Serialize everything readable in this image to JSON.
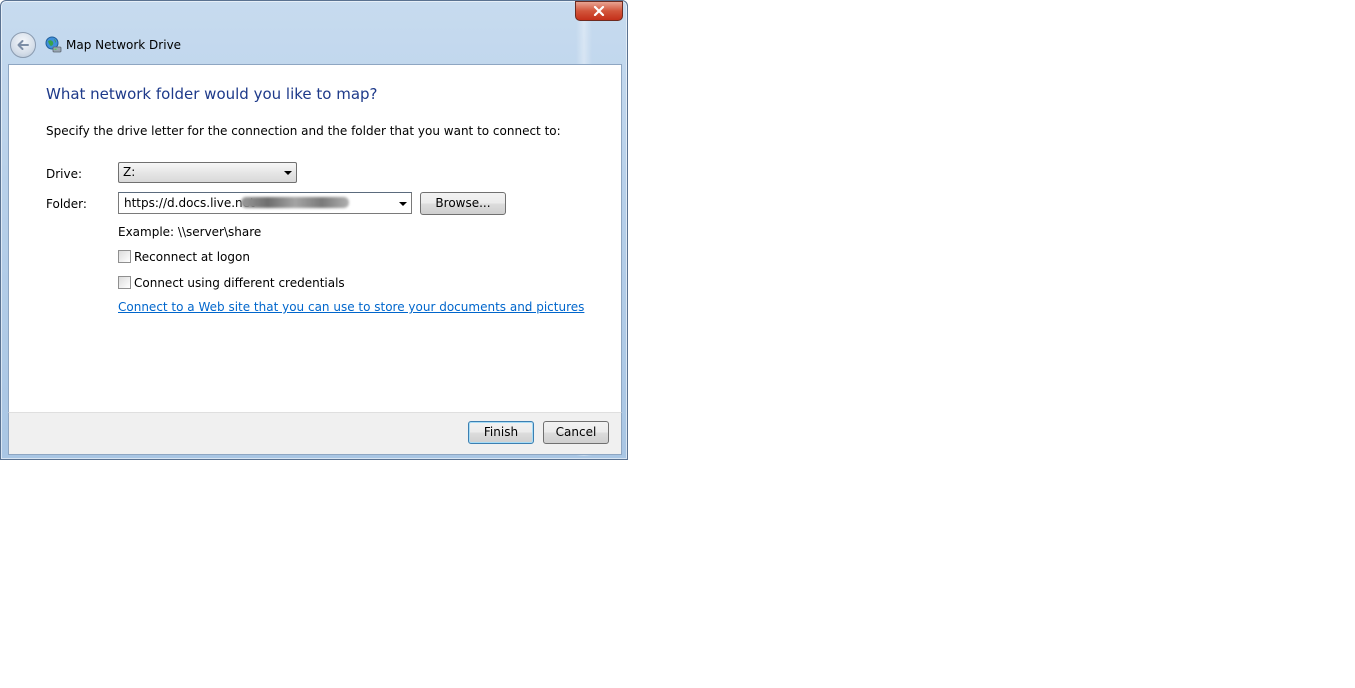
{
  "window": {
    "title": "Map Network Drive"
  },
  "page": {
    "heading": "What network folder would you like to map?",
    "instruction": "Specify the drive letter for the connection and the folder that you want to connect to:"
  },
  "drive": {
    "label": "Drive:",
    "value": "Z:"
  },
  "folder": {
    "label": "Folder:",
    "value": "https://d.docs.live.net",
    "browse_label": "Browse...",
    "example": "Example: \\\\server\\share"
  },
  "options": {
    "reconnect_label": "Reconnect at logon",
    "reconnect_checked": false,
    "credentials_label": "Connect using different credentials",
    "credentials_checked": false
  },
  "link": {
    "text": "Connect to a Web site that you can use to store your documents and pictures",
    "suffix": "."
  },
  "buttons": {
    "finish": "Finish",
    "cancel": "Cancel"
  }
}
